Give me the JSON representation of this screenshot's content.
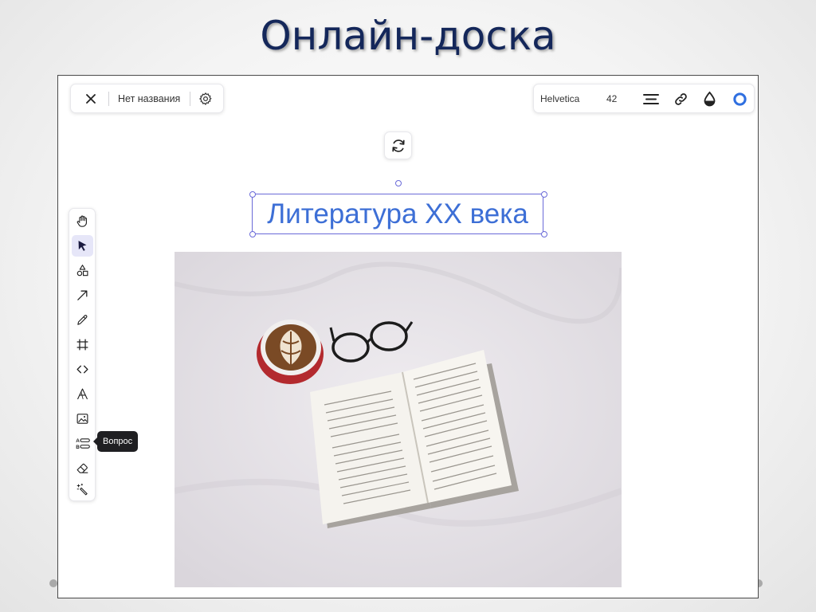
{
  "slide": {
    "title": "Онлайн-доска"
  },
  "top_left_toolbar": {
    "document_name": "Нет названия"
  },
  "top_right_toolbar": {
    "font_family": "Helvetica",
    "font_size": "42"
  },
  "left_toolbar": {
    "tools": [
      {
        "name": "hand",
        "icon": "hand-icon"
      },
      {
        "name": "select",
        "icon": "cursor-icon",
        "active": true
      },
      {
        "name": "shapes",
        "icon": "shapes-icon"
      },
      {
        "name": "arrow",
        "icon": "arrow-icon"
      },
      {
        "name": "pen",
        "icon": "pencil-icon"
      },
      {
        "name": "frame",
        "icon": "frame-icon"
      },
      {
        "name": "embed",
        "icon": "code-icon"
      },
      {
        "name": "text",
        "icon": "text-icon"
      },
      {
        "name": "image",
        "icon": "image-icon"
      },
      {
        "name": "question",
        "icon": "question-list-icon"
      },
      {
        "name": "eraser",
        "icon": "eraser-icon"
      },
      {
        "name": "laser",
        "icon": "magic-wand-icon"
      }
    ],
    "tooltip": "Вопрос"
  },
  "canvas": {
    "text_object": "Литература XX века"
  },
  "colors": {
    "title": "#14275a",
    "text_object": "#3d6fd6",
    "selection": "#6a6ad8",
    "ring_accent": "#2f6fe0"
  }
}
